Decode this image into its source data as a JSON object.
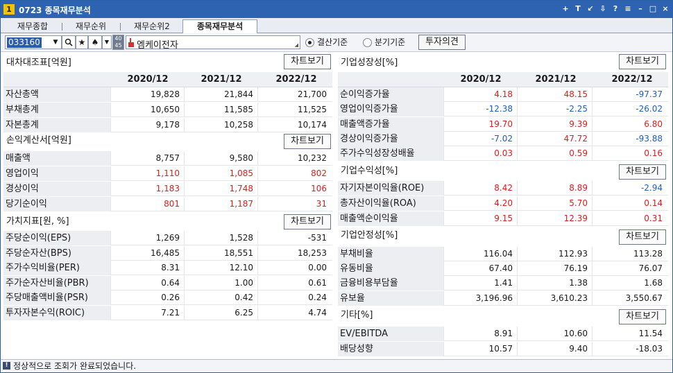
{
  "window": {
    "number": "1",
    "title": "0723 종목재무분석",
    "controls": [
      "+",
      "T",
      "↙",
      "⇩",
      "?",
      "≡",
      "–",
      "□",
      "×"
    ]
  },
  "tabs": [
    {
      "label": "재무종합"
    },
    {
      "label": "재무순위"
    },
    {
      "label": "재무순위2"
    },
    {
      "label": "종목재무분석"
    }
  ],
  "toolbar": {
    "code": "033160",
    "stack_top": "40",
    "stack_bottom": "45",
    "stock_name": "엠케이전자",
    "radio_annual": "결산기준",
    "radio_quarter": "분기기준",
    "invest_btn": "투자의견"
  },
  "columns": [
    "2020/12",
    "2021/12",
    "2022/12"
  ],
  "chart_btn": "차트보기",
  "left": {
    "balance": {
      "title": "대차대조표[억원]",
      "rows": [
        {
          "label": "자산총액",
          "values": [
            "19,828",
            "21,844",
            "21,700"
          ],
          "colors": [
            "k",
            "k",
            "k"
          ]
        },
        {
          "label": "부채총계",
          "values": [
            "10,650",
            "11,585",
            "11,525"
          ],
          "colors": [
            "k",
            "k",
            "k"
          ]
        },
        {
          "label": "자본총계",
          "values": [
            "9,178",
            "10,258",
            "10,174"
          ],
          "colors": [
            "k",
            "k",
            "k"
          ]
        }
      ]
    },
    "income": {
      "title": "손익계산서[억원]",
      "rows": [
        {
          "label": "매출액",
          "values": [
            "8,757",
            "9,580",
            "10,232"
          ],
          "colors": [
            "k",
            "k",
            "k"
          ]
        },
        {
          "label": "영업이익",
          "values": [
            "1,110",
            "1,085",
            "802"
          ],
          "colors": [
            "r",
            "r",
            "r"
          ]
        },
        {
          "label": "경상이익",
          "values": [
            "1,183",
            "1,748",
            "106"
          ],
          "colors": [
            "r",
            "r",
            "r"
          ]
        },
        {
          "label": "당기순이익",
          "values": [
            "801",
            "1,187",
            "31"
          ],
          "colors": [
            "r",
            "r",
            "r"
          ]
        }
      ]
    },
    "value": {
      "title": "가치지표[원, %]",
      "rows": [
        {
          "label": "주당순이익(EPS)",
          "values": [
            "1,269",
            "1,528",
            "-531"
          ],
          "colors": [
            "k",
            "k",
            "k"
          ]
        },
        {
          "label": "주당순자산(BPS)",
          "values": [
            "16,485",
            "18,551",
            "18,253"
          ],
          "colors": [
            "k",
            "k",
            "k"
          ]
        },
        {
          "label": "주가수익비율(PER)",
          "values": [
            "8.31",
            "12.10",
            "0.00"
          ],
          "colors": [
            "k",
            "k",
            "k"
          ]
        },
        {
          "label": "주가순자산비율(PBR)",
          "values": [
            "0.64",
            "1.00",
            "0.61"
          ],
          "colors": [
            "k",
            "k",
            "k"
          ]
        },
        {
          "label": "주당매출액비율(PSR)",
          "values": [
            "0.26",
            "0.42",
            "0.24"
          ],
          "colors": [
            "k",
            "k",
            "k"
          ]
        },
        {
          "label": "투자자본수익(ROIC)",
          "values": [
            "7.21",
            "6.25",
            "4.74"
          ],
          "colors": [
            "k",
            "k",
            "k"
          ]
        }
      ]
    }
  },
  "right": {
    "growth": {
      "title": "기업성장성[%]",
      "rows": [
        {
          "label": "순이익증가율",
          "values": [
            "4.18",
            "48.15",
            "-97.37"
          ],
          "colors": [
            "r",
            "r",
            "b"
          ]
        },
        {
          "label": "영업이익증가율",
          "values": [
            "-12.38",
            "-2.25",
            "-26.02"
          ],
          "colors": [
            "b",
            "b",
            "b"
          ]
        },
        {
          "label": "매출액증가율",
          "values": [
            "19.70",
            "9.39",
            "6.80"
          ],
          "colors": [
            "r",
            "r",
            "r"
          ]
        },
        {
          "label": "경상이익증가율",
          "values": [
            "-7.02",
            "47.72",
            "-93.88"
          ],
          "colors": [
            "b",
            "r",
            "b"
          ]
        },
        {
          "label": "주가수익성장성배율",
          "values": [
            "0.03",
            "0.59",
            "0.16"
          ],
          "colors": [
            "r",
            "r",
            "r"
          ]
        }
      ]
    },
    "profit": {
      "title": "기업수익성[%]",
      "rows": [
        {
          "label": "자기자본이익율(ROE)",
          "values": [
            "8.42",
            "8.89",
            "-2.94"
          ],
          "colors": [
            "r",
            "r",
            "b"
          ]
        },
        {
          "label": "총자산이익율(ROA)",
          "values": [
            "4.20",
            "5.70",
            "0.14"
          ],
          "colors": [
            "r",
            "r",
            "r"
          ]
        },
        {
          "label": "매출액순이익율",
          "values": [
            "9.15",
            "12.39",
            "0.31"
          ],
          "colors": [
            "r",
            "r",
            "r"
          ]
        }
      ]
    },
    "stability": {
      "title": "기업안정성[%]",
      "rows": [
        {
          "label": "부채비율",
          "values": [
            "116.04",
            "112.93",
            "113.28"
          ],
          "colors": [
            "k",
            "k",
            "k"
          ]
        },
        {
          "label": "유동비율",
          "values": [
            "67.40",
            "76.19",
            "76.07"
          ],
          "colors": [
            "k",
            "k",
            "k"
          ]
        },
        {
          "label": "금융비용부담율",
          "values": [
            "1.41",
            "1.38",
            "1.68"
          ],
          "colors": [
            "k",
            "k",
            "k"
          ]
        },
        {
          "label": "유보율",
          "values": [
            "3,196.96",
            "3,610.23",
            "3,550.67"
          ],
          "colors": [
            "k",
            "k",
            "k"
          ]
        }
      ]
    },
    "etc": {
      "title": "기타[%]",
      "rows": [
        {
          "label": "EV/EBITDA",
          "values": [
            "8.91",
            "10.60",
            "11.54"
          ],
          "colors": [
            "k",
            "k",
            "k"
          ]
        },
        {
          "label": "배당성향",
          "values": [
            "10.57",
            "9.40",
            "-18.03"
          ],
          "colors": [
            "k",
            "k",
            "k"
          ]
        }
      ]
    }
  },
  "status": {
    "icon": "!",
    "text": "정상적으로 조회가 완료되었습니다."
  },
  "colors": {
    "title_bar": "#2e63b1",
    "positive": "#e01b1b",
    "negative": "#1b5ec9"
  }
}
